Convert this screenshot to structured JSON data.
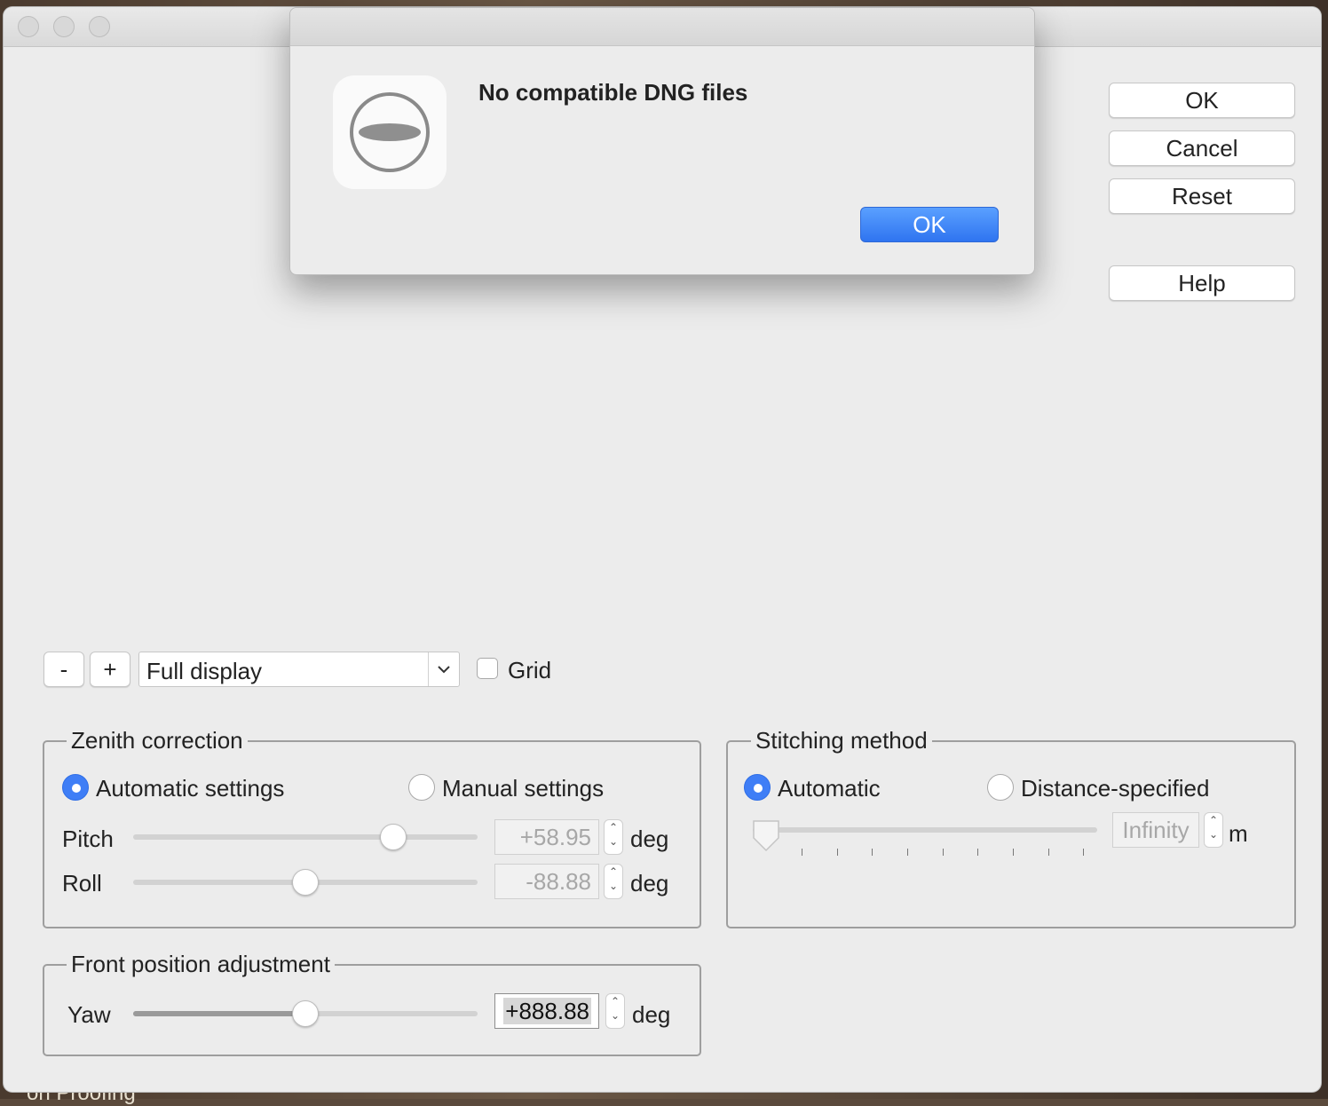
{
  "desktop": {
    "partial_text": "on Proofing"
  },
  "dialog": {
    "message": "No compatible DNG files",
    "ok_label": "OK",
    "icon": "warning-disc-icon"
  },
  "side_buttons": {
    "ok": "OK",
    "cancel": "Cancel",
    "reset": "Reset",
    "help": "Help"
  },
  "toolbar": {
    "zoom_out": "-",
    "zoom_in": "+",
    "display_mode": "Full display",
    "grid_label": "Grid",
    "grid_checked": false
  },
  "zenith": {
    "title": "Zenith correction",
    "auto_label": "Automatic settings",
    "manual_label": "Manual settings",
    "selected": "auto",
    "pitch": {
      "label": "Pitch",
      "value": "+58.95",
      "unit": "deg",
      "level": 0.75
    },
    "roll": {
      "label": "Roll",
      "value": "-88.88",
      "unit": "deg",
      "level": 0.5
    }
  },
  "stitching": {
    "title": "Stitching method",
    "auto_label": "Automatic",
    "distance_label": "Distance-specified",
    "selected": "auto",
    "distance": {
      "value": "Infinity",
      "unit": "m",
      "level": 0.0
    }
  },
  "front": {
    "title": "Front position adjustment",
    "yaw": {
      "label": "Yaw",
      "value": "+888.88",
      "unit": "deg",
      "level": 0.5
    }
  }
}
